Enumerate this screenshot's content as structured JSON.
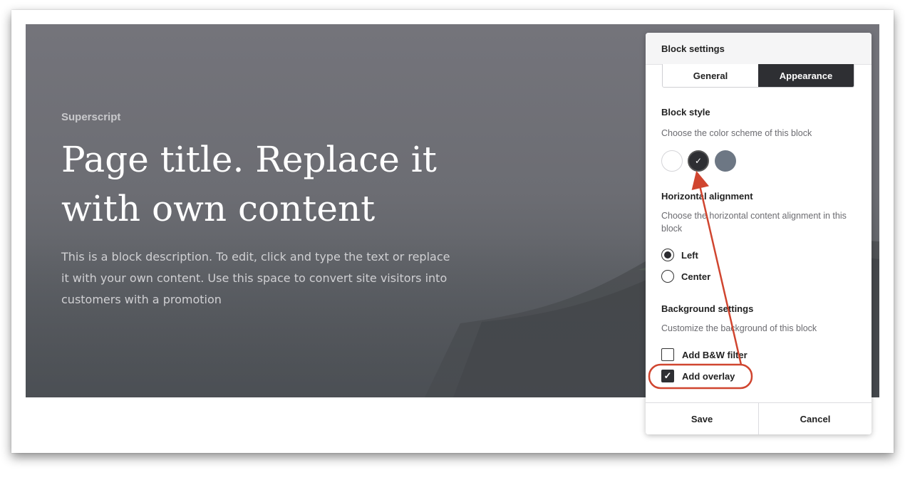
{
  "hero": {
    "superscript": "Superscript",
    "title": "Page title. Replace it with own content",
    "description": "This is a block description. To edit, click and type the text or replace it with your own content. Use this space to convert site visitors into customers with a promotion"
  },
  "panel": {
    "header": "Block settings",
    "tabs": [
      {
        "label": "General",
        "active": false
      },
      {
        "label": "Appearance",
        "active": true
      }
    ],
    "block_style": {
      "title": "Block style",
      "description": "Choose the color scheme of this block",
      "swatches": [
        {
          "name": "white",
          "color": "#ffffff",
          "selected": false
        },
        {
          "name": "dark",
          "color": "#2e2f33",
          "selected": true
        },
        {
          "name": "grey",
          "color": "#6d7784",
          "selected": false
        }
      ],
      "check_glyph": "✓"
    },
    "alignment": {
      "title": "Horizontal alignment",
      "description": "Choose the horizontal content alignment in this block",
      "options": [
        {
          "label": "Left",
          "selected": true
        },
        {
          "label": "Center",
          "selected": false
        }
      ]
    },
    "background": {
      "title": "Background settings",
      "description": "Customize the background of this block",
      "options": [
        {
          "label": "Add B&W filter",
          "checked": false
        },
        {
          "label": "Add overlay",
          "checked": true
        }
      ],
      "check_glyph": "✓"
    },
    "footer": {
      "save": "Save",
      "cancel": "Cancel"
    }
  },
  "colors": {
    "annotation": "#d0452f",
    "accent_dark": "#2e2f33"
  }
}
